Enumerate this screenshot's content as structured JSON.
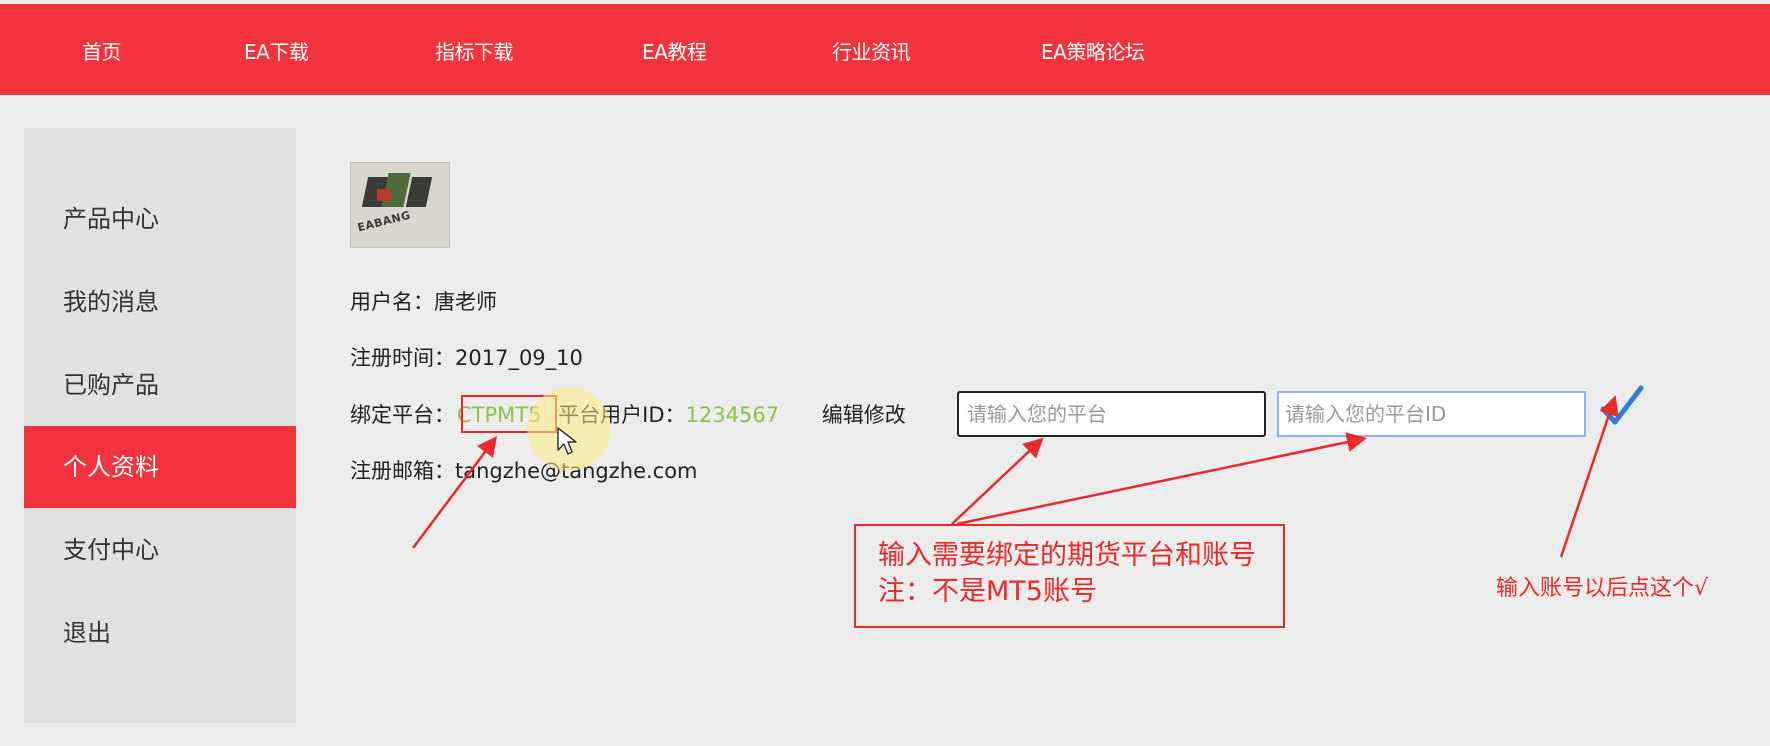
{
  "nav": {
    "items": [
      {
        "label": "首页"
      },
      {
        "label": "EA下载"
      },
      {
        "label": "指标下载"
      },
      {
        "label": "EA教程"
      },
      {
        "label": "行业资讯"
      },
      {
        "label": "EA策略论坛"
      }
    ]
  },
  "sidebar": {
    "items": [
      {
        "label": "产品中心"
      },
      {
        "label": "我的消息"
      },
      {
        "label": "已购产品"
      },
      {
        "label": "个人资料",
        "active": true
      },
      {
        "label": "支付中心"
      },
      {
        "label": "退出"
      }
    ]
  },
  "profile": {
    "logo_text": "EABANG",
    "username_label": "用户名：",
    "username": "唐老师",
    "reg_time_label": "注册时间：",
    "reg_time": "2017_09_10",
    "platform_label": "绑定平台：",
    "platform": "CTPMT5",
    "platform_id_label": "平台用户ID：",
    "platform_id": "1234567",
    "edit_label": "编辑修改",
    "platform_input": {
      "value": "",
      "placeholder": "请输入您的平台"
    },
    "platform_id_input": {
      "value": "",
      "placeholder": "请输入您的平台ID"
    },
    "email_label": "注册邮箱：",
    "email": "tangzhe@tangzhe.com"
  },
  "annotations": {
    "note_line1": "输入需要绑定的期货平台和账号",
    "note_line2": "注：不是MT5账号",
    "right_note": "输入账号以后点这个√"
  },
  "colors": {
    "brand_red": "#f1333d",
    "annotation_red": "#e82a2a",
    "value_green": "#8bc34a",
    "confirm_blue": "#2f7de1"
  }
}
